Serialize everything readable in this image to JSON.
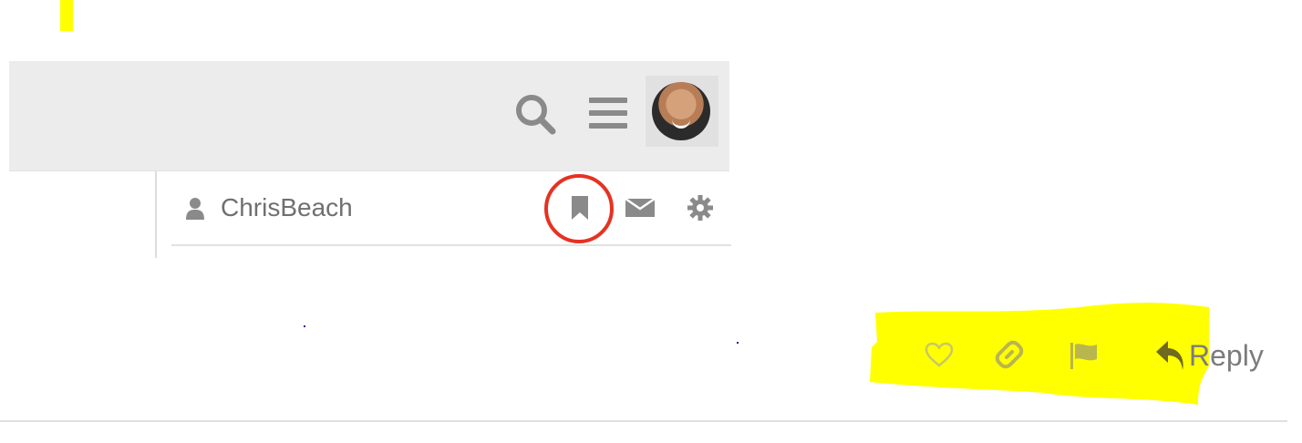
{
  "header": {
    "icons": [
      "search-icon",
      "menu-icon"
    ],
    "avatar": "user-avatar"
  },
  "user_panel": {
    "username": "ChrisBeach",
    "icons": [
      "user-icon",
      "bookmark-icon",
      "mail-icon",
      "gear-icon"
    ]
  },
  "post_actions": {
    "icons": [
      "like-icon",
      "link-icon",
      "flag-icon",
      "reply-icon"
    ],
    "reply_label": "Reply"
  },
  "colors": {
    "highlight": "#ffff00",
    "bookmark_circle": "#e53222",
    "header_bg": "#ececec",
    "icon_gray": "#8a8a8a",
    "action_icon": "#c8c864"
  }
}
